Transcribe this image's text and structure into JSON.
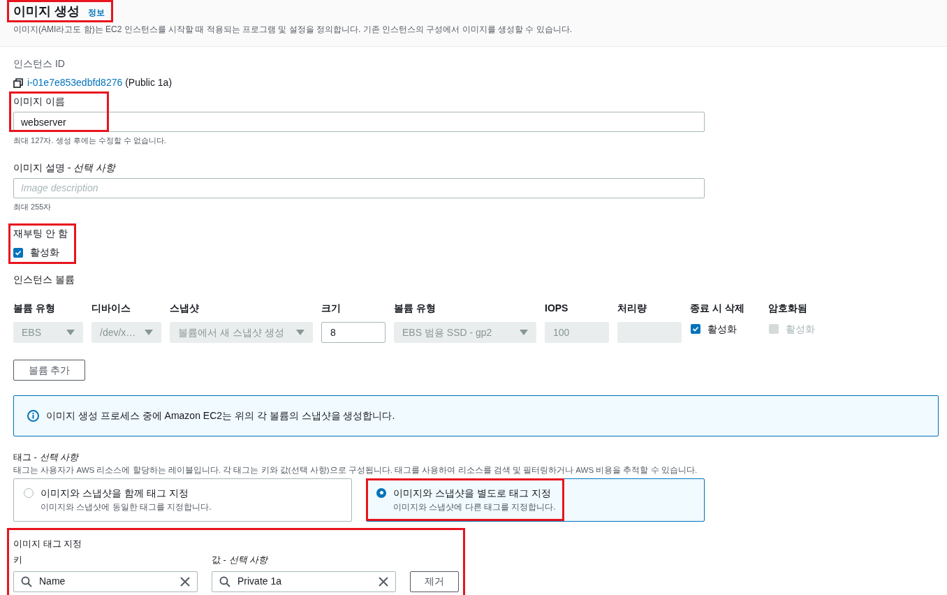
{
  "header": {
    "title": "이미지 생성",
    "info_link": "정보",
    "description": "이미지(AMI라고도 함)는 EC2 인스턴스를 시작할 때 적용되는 프로그램 및 설정을 정의합니다. 기존 인스턴스의 구성에서 이미지를 생성할 수 있습니다."
  },
  "instance": {
    "label": "인스턴스 ID",
    "id_link": "i-01e7e853edbfd8276",
    "id_suffix": "(Public 1a)"
  },
  "image_name": {
    "label": "이미지 이름",
    "value": "webserver",
    "hint": "최대 127자. 생성 후에는 수정할 수 없습니다."
  },
  "image_description": {
    "label": "이미지 설명 - *선택 사항*",
    "placeholder": "Image description",
    "hint": "최대 255자"
  },
  "no_reboot": {
    "label": "재부팅 안 함",
    "checkbox_label": "활성화",
    "checked": true
  },
  "volumes": {
    "label": "인스턴스 볼륨",
    "columns": [
      "볼륨 유형",
      "디바이스",
      "스냅샷",
      "크기",
      "볼륨 유형",
      "IOPS",
      "처리량",
      "종료 시 삭제",
      "암호화됨"
    ],
    "cells": [
      {
        "kind": "select",
        "value": "EBS",
        "disabled": true
      },
      {
        "kind": "select",
        "value": "/dev/x…",
        "disabled": true
      },
      {
        "kind": "select",
        "value": "볼륨에서 새 스냅샷 생성",
        "disabled": true
      },
      {
        "kind": "input",
        "value": "8",
        "disabled": false
      },
      {
        "kind": "select",
        "value": "EBS 범용 SSD - gp2",
        "disabled": true
      },
      {
        "kind": "input",
        "value": "100",
        "disabled": true
      },
      {
        "kind": "input",
        "disabled": true
      },
      {
        "kind": "checkbox",
        "label": "활성화",
        "checked": true,
        "disabled": false
      },
      {
        "kind": "checkbox",
        "label": "활성화",
        "checked": false,
        "disabled": true
      }
    ],
    "add_button": "볼륨 추가"
  },
  "info_banner": "이미지 생성 프로세스 중에 Amazon EC2는 위의 각 볼륨의 스냅샷을 생성합니다.",
  "tags": {
    "label": "태그 - *선택 사항*",
    "description": "태그는 사용자가 AWS 리소스에 할당하는 레이블입니다. 각 태그는 키와 값(선택 사항)으로 구성됩니다. 태그를 사용하여 리소스를 검색 및 필터링하거나 AWS 비용을 추적할 수 있습니다.",
    "options": [
      {
        "title": "이미지와 스냅샷을 함께 태그 지정",
        "subtitle": "이미지와 스냅샷에 동일한 태그를 지정합니다.",
        "selected": false
      },
      {
        "title": "이미지와 스냅샷을 별도로 태그 지정",
        "subtitle": "이미지와 스냅샷에 다른 태그를 지정합니다.",
        "selected": true
      }
    ]
  },
  "image_tags": {
    "label": "이미지 태그 지정",
    "key_label": "키",
    "value_label": "값 - *선택 사항*",
    "rows": [
      {
        "key": "Name",
        "value": "Private 1a",
        "remove": "제거"
      }
    ]
  }
}
